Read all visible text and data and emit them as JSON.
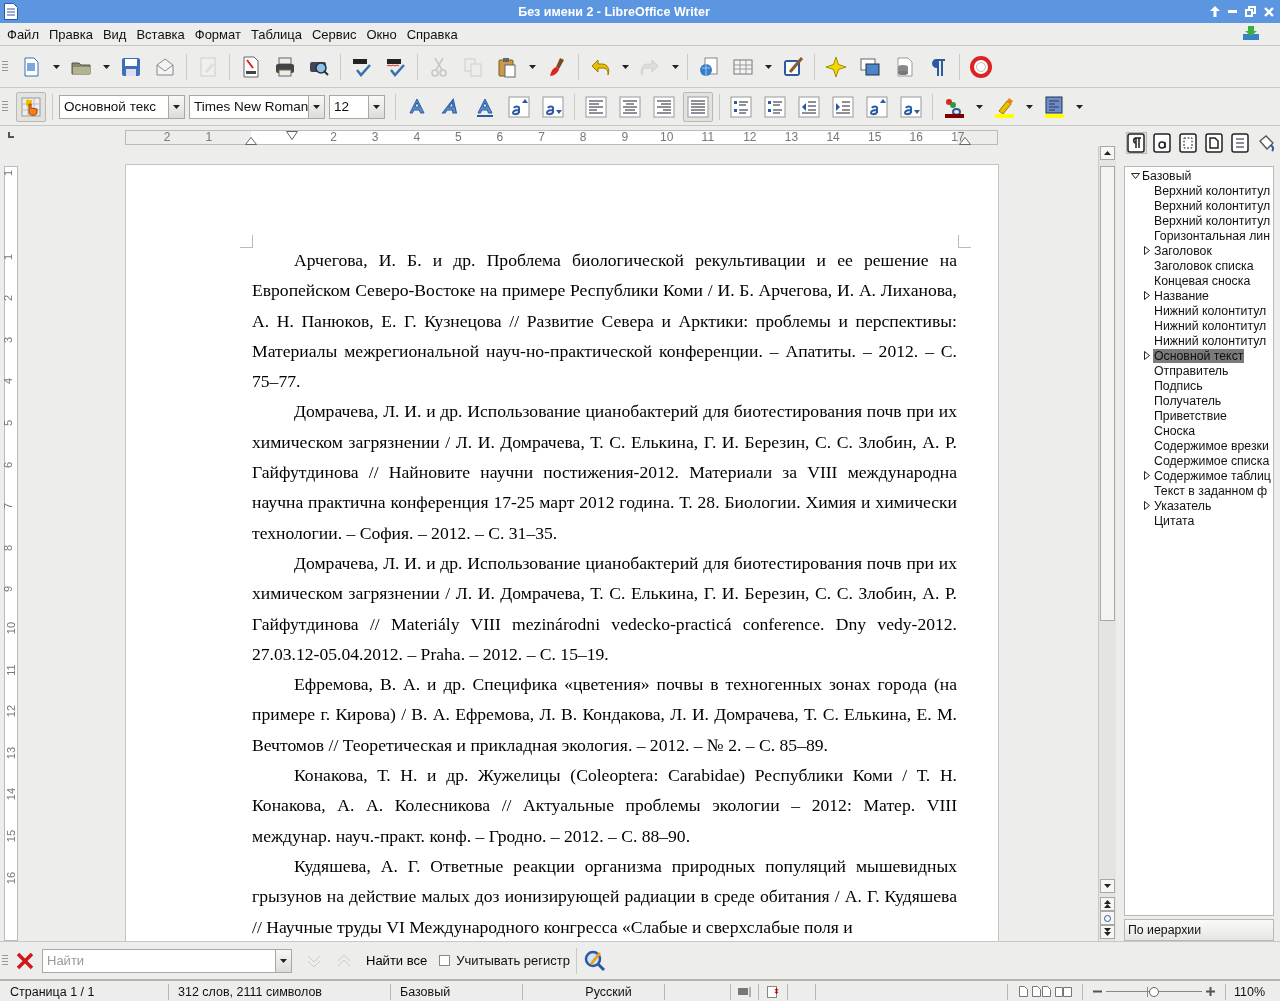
{
  "window": {
    "title": "Без имени 2 - LibreOffice Writer"
  },
  "menu": [
    "Файл",
    "Правка",
    "Вид",
    "Вставка",
    "Формат",
    "Таблица",
    "Сервис",
    "Окно",
    "Справка"
  ],
  "standard_toolbar": [
    [
      {
        "kind": "new",
        "dropdown": true,
        "disabled": false
      },
      {
        "kind": "open",
        "dropdown": true,
        "disabled": false
      },
      {
        "kind": "save",
        "disabled": false
      },
      {
        "kind": "email",
        "disabled": false
      }
    ],
    [
      {
        "kind": "edit",
        "disabled": true
      }
    ],
    [
      {
        "kind": "pdf",
        "disabled": false
      },
      {
        "kind": "print",
        "disabled": false
      },
      {
        "kind": "preview",
        "disabled": false
      }
    ],
    [
      {
        "kind": "spell",
        "disabled": false
      },
      {
        "kind": "autospell",
        "disabled": false
      }
    ],
    [
      {
        "kind": "cut",
        "disabled": true
      },
      {
        "kind": "copy",
        "disabled": true
      },
      {
        "kind": "paste",
        "dropdown": true,
        "disabled": false
      },
      {
        "kind": "clone",
        "disabled": false
      }
    ],
    [
      {
        "kind": "undo",
        "dropdown": true,
        "disabled": false
      },
      {
        "kind": "redo",
        "dropdown": true,
        "disabled": true
      }
    ],
    [
      {
        "kind": "navigator",
        "disabled": false
      },
      {
        "kind": "table",
        "dropdown": true,
        "disabled": false
      },
      {
        "kind": "draw",
        "disabled": false
      }
    ],
    [
      {
        "kind": "gallery",
        "disabled": false
      },
      {
        "kind": "frame",
        "disabled": false
      },
      {
        "kind": "datasource",
        "disabled": false
      },
      {
        "kind": "pilcrow",
        "disabled": false
      }
    ],
    [
      {
        "kind": "help",
        "disabled": false
      }
    ]
  ],
  "formatting_toolbar": {
    "styles_button": {
      "pressed": true
    },
    "paragraph_style": "Основной текс",
    "font_name": "Times New Roman",
    "font_size": "12",
    "groups": [
      [
        {
          "kind": "bold",
          "pressed": false
        },
        {
          "kind": "italic",
          "pressed": false
        },
        {
          "kind": "underline",
          "pressed": false
        },
        {
          "kind": "superscript",
          "pressed": false
        },
        {
          "kind": "subscript",
          "pressed": false
        }
      ],
      [
        {
          "kind": "align_left",
          "pressed": false
        },
        {
          "kind": "align_center",
          "pressed": false
        },
        {
          "kind": "align_right",
          "pressed": false
        },
        {
          "kind": "justify",
          "pressed": true
        }
      ],
      [
        {
          "kind": "numbering",
          "pressed": false
        },
        {
          "kind": "bullets",
          "pressed": false
        },
        {
          "kind": "outdent",
          "pressed": false
        },
        {
          "kind": "indent",
          "pressed": false
        },
        {
          "kind": "grow",
          "pressed": false
        },
        {
          "kind": "shrink",
          "pressed": false
        }
      ],
      [
        {
          "kind": "font_color",
          "pressed": false,
          "dropdown": true
        },
        {
          "kind": "highlight",
          "pressed": false,
          "dropdown": true
        },
        {
          "kind": "background",
          "pressed": false,
          "dropdown": true
        }
      ]
    ]
  },
  "ruler": {
    "left_labels": [
      "2",
      "1"
    ],
    "right_labels": [
      "2",
      "3",
      "4",
      "5",
      "6",
      "7",
      "8",
      "9",
      "10",
      "11",
      "12",
      "13",
      "14",
      "15",
      "16",
      "17"
    ]
  },
  "vertical_ruler": {
    "top_labels": [
      "1"
    ],
    "labels": [
      "1",
      "2",
      "3",
      "4",
      "5",
      "6",
      "7",
      "8",
      "9",
      "10",
      "11",
      "12",
      "13",
      "14",
      "15",
      "16"
    ]
  },
  "document": {
    "paragraphs": [
      "Арчегова, И. Б. и др. Проблема биологической рекультивации и ее решение на Европейском Северо-Востоке на примере Республики Коми / И. Б. Арчегова, И. А. Лиханова, А. Н. Панюков, Е. Г. Кузнецова // Развитие Севера и Арктики: проблемы и перспективы: Материалы межрегиональной науч-но-практической конференции. – Апатиты. – 2012. – С. 75–77.",
      "Домрачева, Л. И. и др. Использование цианобактерий для биотестирования почв при их химическом загрязнении / Л. И. Домрачева, Т. С. Елькина, Г. И. Березин, С. С. Злобин, А. Р. Гайфутдинова // Найновите научни постижения-2012. Материали за VIII международна научна практична конференция 17-25 март 2012 година. Т. 28. Биологии. Химия и химически технологии. – София. – 2012. – С. 31–35.",
      "Домрачева, Л. И. и др. Использование цианобактерий для биотестирования почв при их химическом загрязнении / Л. И. Домрачева, Т. С. Елькина, Г. И. Березин, С. С. Злобин, А. Р. Гайфутдинова // Materiály VIII mezinárodni vedecko-practicá conference. Dny vedy-2012. 27.03.12-05.04.2012. – Praha. – 2012. – С. 15–19.",
      "Ефремова, В. А. и др. Специфика «цветения» почвы в техногенных зонах города (на примере г. Кирова) / В. А. Ефремова, Л. В. Кондакова, Л. И. Домрачева, Т. С. Елькина, Е. М. Вечтомов // Теоретическая и прикладная экология. – 2012. – № 2. – С. 85–89.",
      "Конакова, Т. Н. и др. Жужелицы (Coleoptera: Carabidae) Республики Коми / Т. Н. Конакова, А. А. Колесникова // Актуальные проблемы экологии – 2012: Матер. VIII междунар. науч.-практ. конф. – Гродно. – 2012. – С. 88–90.",
      "Кудяшева, А. Г. Ответные реакции организма природных популяций мышевидных грызунов на действие малых доз ионизирующей радиации в среде обитания / А. Г. Кудяшева // Научные труды VI Международного конгресса «Слабые и сверхслабые поля и"
    ]
  },
  "sidebar": {
    "tabs": [
      {
        "kind": "paragraph",
        "selected": true
      },
      {
        "kind": "character",
        "selected": false
      },
      {
        "kind": "frame",
        "selected": false
      },
      {
        "kind": "page",
        "selected": false
      },
      {
        "kind": "list",
        "selected": false
      },
      {
        "kind": "fill",
        "selected": false
      }
    ],
    "tree": [
      {
        "label": "Базовый",
        "expanded": true,
        "selected": false,
        "children": [
          {
            "label": "Верхний колонтитул",
            "has_children": false,
            "selected": false
          },
          {
            "label": "Верхний колонтитул",
            "has_children": false,
            "selected": false
          },
          {
            "label": "Верхний колонтитул",
            "has_children": false,
            "selected": false
          },
          {
            "label": "Горизонтальная лин",
            "has_children": false,
            "selected": false
          },
          {
            "label": "Заголовок",
            "has_children": true,
            "selected": false
          },
          {
            "label": "Заголовок списка",
            "has_children": false,
            "selected": false
          },
          {
            "label": "Концевая сноска",
            "has_children": false,
            "selected": false
          },
          {
            "label": "Название",
            "has_children": true,
            "selected": false
          },
          {
            "label": "Нижний колонтитул",
            "has_children": false,
            "selected": false
          },
          {
            "label": "Нижний колонтитул",
            "has_children": false,
            "selected": false
          },
          {
            "label": "Нижний колонтитул",
            "has_children": false,
            "selected": false
          },
          {
            "label": "Основной текст",
            "has_children": true,
            "selected": true
          },
          {
            "label": "Отправитель",
            "has_children": false,
            "selected": false
          },
          {
            "label": "Подпись",
            "has_children": false,
            "selected": false
          },
          {
            "label": "Получатель",
            "has_children": false,
            "selected": false
          },
          {
            "label": "Приветствие",
            "has_children": false,
            "selected": false
          },
          {
            "label": "Сноска",
            "has_children": false,
            "selected": false
          },
          {
            "label": "Содержимое врезки",
            "has_children": false,
            "selected": false
          },
          {
            "label": "Содержимое списка",
            "has_children": false,
            "selected": false
          },
          {
            "label": "Содержимое таблиц",
            "has_children": true,
            "selected": false
          },
          {
            "label": "Текст в заданном ф",
            "has_children": false,
            "selected": false
          },
          {
            "label": "Указатель",
            "has_children": true,
            "selected": false
          },
          {
            "label": "Цитата",
            "has_children": false,
            "selected": false
          }
        ]
      }
    ],
    "filter": "По иерархии"
  },
  "find_bar": {
    "placeholder": "Найти",
    "find_all": "Найти все",
    "match_case": {
      "label": "Учитывать регистр",
      "checked": false
    }
  },
  "status_bar": {
    "page": "Страница 1 / 1",
    "word_count": "312 слов, 2111 символов",
    "page_style": "Базовый",
    "language": "Русский",
    "zoom": {
      "level": 0.5,
      "reading": "110%"
    }
  }
}
